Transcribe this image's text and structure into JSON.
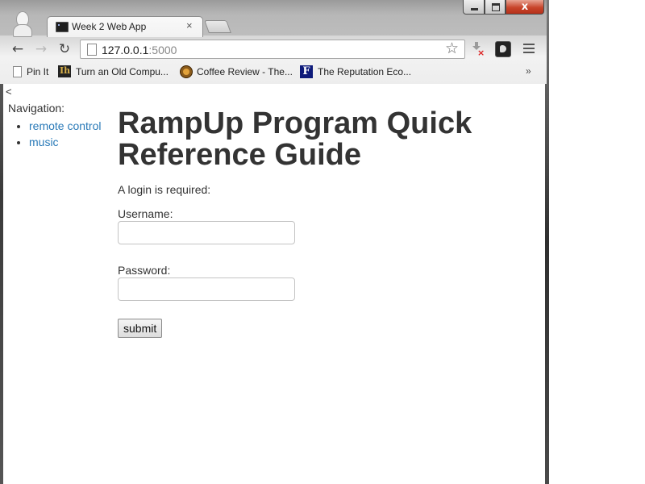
{
  "browser": {
    "tab": {
      "title": "Week 2 Web App",
      "close_glyph": "×"
    },
    "window_controls": {
      "close_glyph": "x"
    },
    "address_bar": {
      "host": "127.0.0.1",
      "port": ":5000"
    },
    "toolbar": {
      "back_glyph": "←",
      "forward_glyph": "→",
      "reload_glyph": "↻",
      "star_glyph": "☆"
    },
    "bookmarks": [
      {
        "label": "Pin It",
        "icon": "page-icon"
      },
      {
        "label": "Turn an Old Compu...",
        "icon": "ih-icon"
      },
      {
        "label": "Coffee Review - The...",
        "icon": "coffee-icon"
      },
      {
        "label": "The Reputation Eco...",
        "icon": "f-icon",
        "icon_letter": "F"
      }
    ],
    "bookmarks_more": "»"
  },
  "page": {
    "collapse_link": "<",
    "nav": {
      "label": "Navigation:",
      "items": [
        {
          "label": "remote control"
        },
        {
          "label": "music"
        }
      ]
    },
    "title": "RampUp Program Quick Reference Guide",
    "login_note": "A login is required:",
    "form": {
      "username_label": "Username:",
      "username_value": "",
      "password_label": "Password:",
      "password_value": "",
      "submit_label": "submit"
    }
  },
  "colors": {
    "link": "#2a7ab8",
    "text": "#333333",
    "close_button": "#c8452b"
  }
}
